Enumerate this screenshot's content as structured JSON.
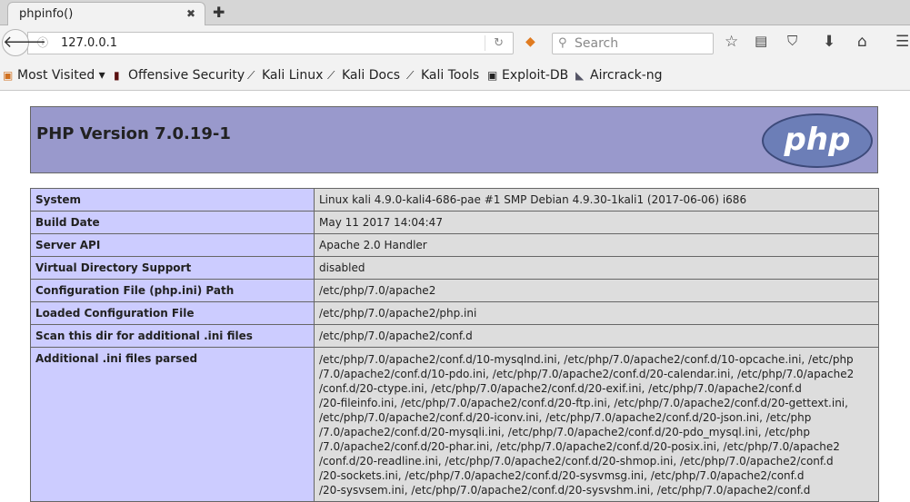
{
  "browser": {
    "tab_title": "phpinfo()",
    "url": "127.0.0.1",
    "search_placeholder": "Search",
    "bookmarks": [
      "Most Visited ▾",
      "Offensive Security",
      "Kali Linux",
      "Kali Docs",
      "Kali Tools",
      "Exploit-DB",
      "Aircrack-ng"
    ]
  },
  "page": {
    "title": "PHP Version 7.0.19-1",
    "logo": "php",
    "rows": [
      {
        "label": "System",
        "value": "Linux kali 4.9.0-kali4-686-pae #1 SMP Debian 4.9.30-1kali1 (2017-06-06) i686"
      },
      {
        "label": "Build Date",
        "value": "May 11 2017 14:04:47"
      },
      {
        "label": "Server API",
        "value": "Apache 2.0 Handler"
      },
      {
        "label": "Virtual Directory Support",
        "value": "disabled"
      },
      {
        "label": "Configuration File (php.ini) Path",
        "value": "/etc/php/7.0/apache2"
      },
      {
        "label": "Loaded Configuration File",
        "value": "/etc/php/7.0/apache2/php.ini"
      },
      {
        "label": "Scan this dir for additional .ini files",
        "value": "/etc/php/7.0/apache2/conf.d"
      }
    ],
    "additional_label": "Additional .ini files parsed",
    "additional_lines": [
      "/etc/php/7.0/apache2/conf.d/10-mysqlnd.ini, /etc/php/7.0/apache2/conf.d/10-opcache.ini, /etc/php",
      "/7.0/apache2/conf.d/10-pdo.ini, /etc/php/7.0/apache2/conf.d/20-calendar.ini, /etc/php/7.0/apache2",
      "/conf.d/20-ctype.ini, /etc/php/7.0/apache2/conf.d/20-exif.ini, /etc/php/7.0/apache2/conf.d",
      "/20-fileinfo.ini, /etc/php/7.0/apache2/conf.d/20-ftp.ini, /etc/php/7.0/apache2/conf.d/20-gettext.ini,",
      "/etc/php/7.0/apache2/conf.d/20-iconv.ini, /etc/php/7.0/apache2/conf.d/20-json.ini, /etc/php",
      "/7.0/apache2/conf.d/20-mysqli.ini, /etc/php/7.0/apache2/conf.d/20-pdo_mysql.ini, /etc/php",
      "/7.0/apache2/conf.d/20-phar.ini, /etc/php/7.0/apache2/conf.d/20-posix.ini, /etc/php/7.0/apache2",
      "/conf.d/20-readline.ini, /etc/php/7.0/apache2/conf.d/20-shmop.ini, /etc/php/7.0/apache2/conf.d",
      "/20-sockets.ini, /etc/php/7.0/apache2/conf.d/20-sysvmsg.ini, /etc/php/7.0/apache2/conf.d",
      "/20-sysvsem.ini, /etc/php/7.0/apache2/conf.d/20-sysvshm.ini, /etc/php/7.0/apache2/conf.d"
    ]
  }
}
